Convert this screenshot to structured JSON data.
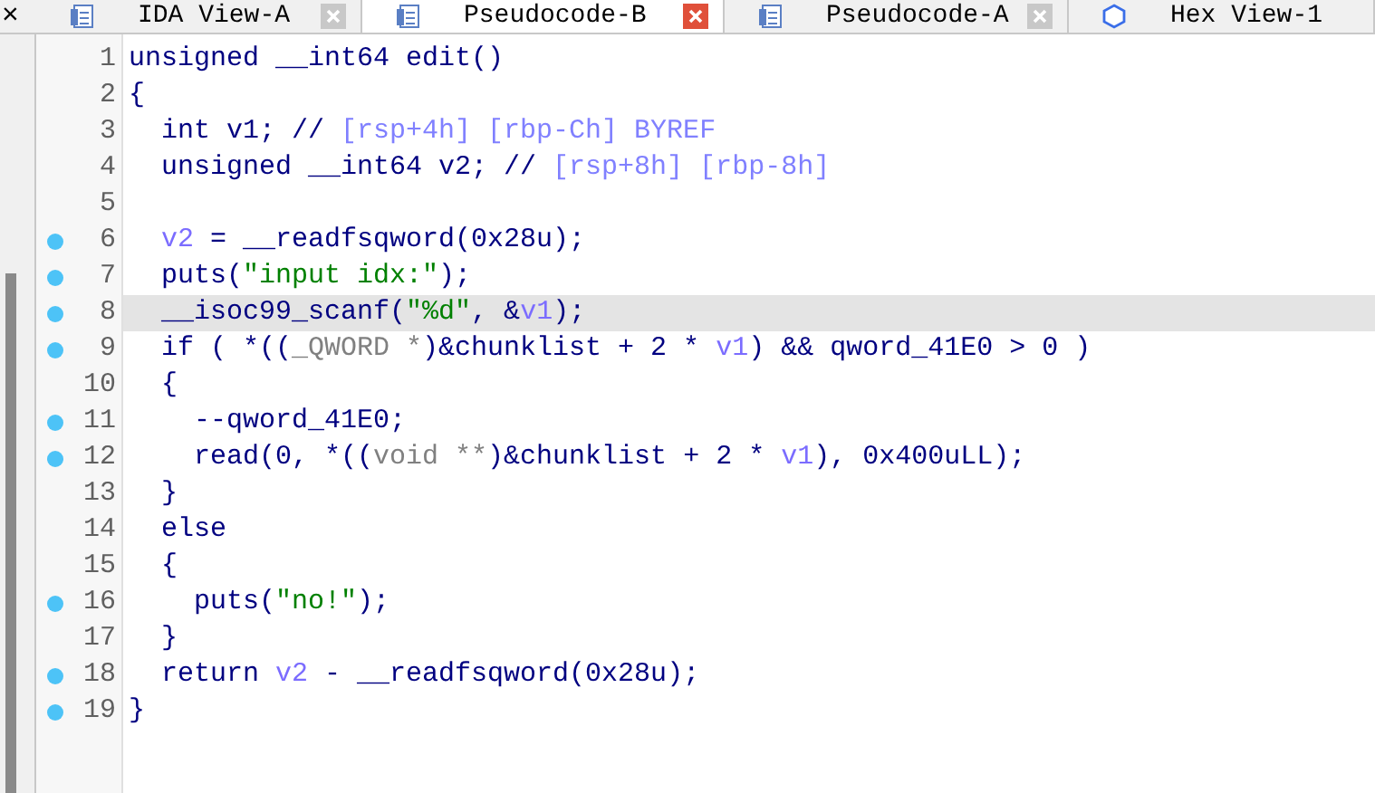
{
  "tabs": [
    {
      "label": "IDA View-A",
      "kind": "doc",
      "selected": false
    },
    {
      "label": "Pseudocode-B",
      "kind": "doc",
      "selected": true
    },
    {
      "label": "Pseudocode-A",
      "kind": "doc",
      "selected": false
    },
    {
      "label": "Hex View-1",
      "kind": "hex",
      "selected": false
    }
  ],
  "close_glyph": "×",
  "code_lines": [
    {
      "number": "1",
      "breakpoint": false,
      "selected": false,
      "tokens": [
        {
          "kind": "code",
          "text": "unsigned __int64 edit()"
        }
      ]
    },
    {
      "number": "2",
      "breakpoint": false,
      "selected": false,
      "tokens": [
        {
          "kind": "code",
          "text": "{"
        }
      ]
    },
    {
      "number": "3",
      "breakpoint": false,
      "selected": false,
      "tokens": [
        {
          "kind": "code",
          "text": "  int v1; // "
        },
        {
          "kind": "comment",
          "text": "[rsp+4h] [rbp-Ch] BYREF"
        }
      ]
    },
    {
      "number": "4",
      "breakpoint": false,
      "selected": false,
      "tokens": [
        {
          "kind": "code",
          "text": "  unsigned __int64 v2; // "
        },
        {
          "kind": "comment",
          "text": "[rsp+8h] [rbp-8h]"
        }
      ]
    },
    {
      "number": "5",
      "breakpoint": false,
      "selected": false
    },
    {
      "number": "6",
      "breakpoint": true,
      "selected": false,
      "tokens": [
        {
          "kind": "var",
          "text": "  v2"
        },
        {
          "kind": "code",
          "text": " = __readfsqword(0x28u);"
        }
      ]
    },
    {
      "number": "7",
      "breakpoint": true,
      "selected": false,
      "tokens": [
        {
          "kind": "code",
          "text": "  puts("
        },
        {
          "kind": "string",
          "text": "\"input idx:\""
        },
        {
          "kind": "code",
          "text": ");"
        }
      ]
    },
    {
      "number": "8",
      "breakpoint": true,
      "selected": true,
      "tokens": [
        {
          "kind": "code",
          "text": "  __isoc99_scanf("
        },
        {
          "kind": "string",
          "text": "\"%d\""
        },
        {
          "kind": "code",
          "text": ", &"
        },
        {
          "kind": "var",
          "text": "v1"
        },
        {
          "kind": "code",
          "text": ");"
        }
      ]
    },
    {
      "number": "9",
      "breakpoint": true,
      "selected": false,
      "tokens": [
        {
          "kind": "code",
          "text": "  if ( *(("
        },
        {
          "kind": "cast",
          "text": "_QWORD *"
        },
        {
          "kind": "code",
          "text": ")&chunklist + 2 * "
        },
        {
          "kind": "var",
          "text": "v1"
        },
        {
          "kind": "code",
          "text": ") && qword_41E0 > 0 )"
        }
      ]
    },
    {
      "number": "10",
      "breakpoint": false,
      "selected": false,
      "tokens": [
        {
          "kind": "code",
          "text": "  {"
        }
      ]
    },
    {
      "number": "11",
      "breakpoint": true,
      "selected": false,
      "tokens": [
        {
          "kind": "code",
          "text": "    --qword_41E0;"
        }
      ]
    },
    {
      "number": "12",
      "breakpoint": true,
      "selected": false,
      "tokens": [
        {
          "kind": "code",
          "text": "    read(0, *(("
        },
        {
          "kind": "cast",
          "text": "void **"
        },
        {
          "kind": "code",
          "text": ")&chunklist + 2 * "
        },
        {
          "kind": "var",
          "text": "v1"
        },
        {
          "kind": "code",
          "text": "), 0x400uLL);"
        }
      ]
    },
    {
      "number": "13",
      "breakpoint": false,
      "selected": false,
      "tokens": [
        {
          "kind": "code",
          "text": "  }"
        }
      ]
    },
    {
      "number": "14",
      "breakpoint": false,
      "selected": false,
      "tokens": [
        {
          "kind": "code",
          "text": "  else"
        }
      ]
    },
    {
      "number": "15",
      "breakpoint": false,
      "selected": false,
      "tokens": [
        {
          "kind": "code",
          "text": "  {"
        }
      ]
    },
    {
      "number": "16",
      "breakpoint": true,
      "selected": false,
      "tokens": [
        {
          "kind": "code",
          "text": "    puts("
        },
        {
          "kind": "string",
          "text": "\"no!\""
        },
        {
          "kind": "code",
          "text": ");"
        }
      ]
    },
    {
      "number": "17",
      "breakpoint": false,
      "selected": false,
      "tokens": [
        {
          "kind": "code",
          "text": "  }"
        }
      ]
    },
    {
      "number": "18",
      "breakpoint": true,
      "selected": false,
      "tokens": [
        {
          "kind": "code",
          "text": "  return "
        },
        {
          "kind": "var",
          "text": "v2"
        },
        {
          "kind": "code",
          "text": " - __readfsqword(0x28u);"
        }
      ]
    },
    {
      "number": "19",
      "breakpoint": true,
      "selected": false,
      "tokens": [
        {
          "kind": "code",
          "text": "}"
        }
      ]
    }
  ]
}
